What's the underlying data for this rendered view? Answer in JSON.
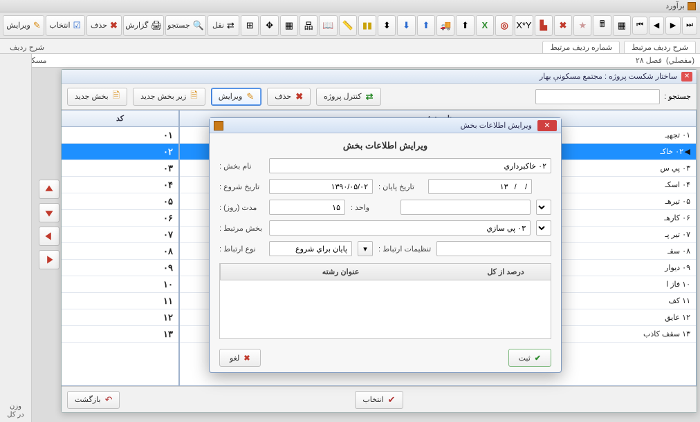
{
  "app": {
    "title": "برآورد"
  },
  "toolbar": {
    "edit": "ویرایش",
    "select": "انتخاب",
    "delete": "حذف",
    "report": "گزارش",
    "search": "جستجو",
    "move": "نقل"
  },
  "ribbon": {
    "row_desc_tab": "شرح ردیف",
    "linked_row_no_tab": "شماره ردیف مرتبط",
    "linked_row_desc_tab": "شرح ردیف مرتبط"
  },
  "info": {
    "project_line": "مسکونې بهار",
    "left1": "(مفصلي)",
    "left2": "فصل ۲۸"
  },
  "left_sidebar": {
    "label1": "وزن",
    "label2": "در کل"
  },
  "inner": {
    "title": "ساختار شکست پروژه : مجتمع مسکونې بهار",
    "btn_new_section": "بخش جدید",
    "btn_new_subsection": "زیر بخش جدید",
    "btn_edit": "ویرایش",
    "btn_delete": "حذف",
    "btn_project_control": "کنترل پروژه",
    "search_label": "جستجو :",
    "col_code": "کد",
    "col_name": "نام بخش",
    "rows": [
      {
        "code": "۰۱",
        "name": "۰۱ تجهیـ"
      },
      {
        "code": "۰۲",
        "name": "۰۲ خاکـ"
      },
      {
        "code": "۰۳",
        "name": "۰۳ پي س"
      },
      {
        "code": "۰۴",
        "name": "۰۴ اسکـ"
      },
      {
        "code": "۰۵",
        "name": "۰۵ تیرهـ"
      },
      {
        "code": "۰۶",
        "name": "۰۶ کارهـ"
      },
      {
        "code": "۰۷",
        "name": "۰۷ تیر پـ"
      },
      {
        "code": "۰۸",
        "name": "۰۸ سقـ"
      },
      {
        "code": "۰۹",
        "name": "۰۹ دیوار"
      },
      {
        "code": "۱۰",
        "name": "۱۰ فاز ا"
      },
      {
        "code": "۱۱",
        "name": "۱۱ کف"
      },
      {
        "code": "۱۲",
        "name": "۱۲ عایق"
      },
      {
        "code": "۱۳",
        "name": "۱۳ سقف کاذب"
      }
    ],
    "selected_index": 1,
    "footer_select": "انتخاب",
    "footer_back": "بازگشت"
  },
  "modal": {
    "title": "ویرایش اطلاعات بخش",
    "heading": "ویرایش اطلاعات بخش",
    "name_label": "نام بخش :",
    "name_value": "۰۲ خاکبرداري",
    "start_label": "تاریخ شروع :",
    "start_value": "۱۳۹۰/۰۵/۰۲",
    "end_label": "تاریخ پایان :",
    "end_value": "۱۳   /    /",
    "duration_label": "مدت (روز) :",
    "duration_value": "۱۵",
    "unit_label": "واحد :",
    "unit_value": "",
    "linked_label": "بخش مرتبط :",
    "linked_value": "۰۳ پي سازي",
    "link_type_label": "نوع ارتباط :",
    "link_type_value": "پایان براي شروع",
    "link_settings_label": "تنظیمات ارتباط :",
    "grid_col_title": "عنوان رشته",
    "grid_col_pct": "درصد از کل",
    "btn_submit": "ثبت",
    "btn_cancel": "لغو"
  }
}
